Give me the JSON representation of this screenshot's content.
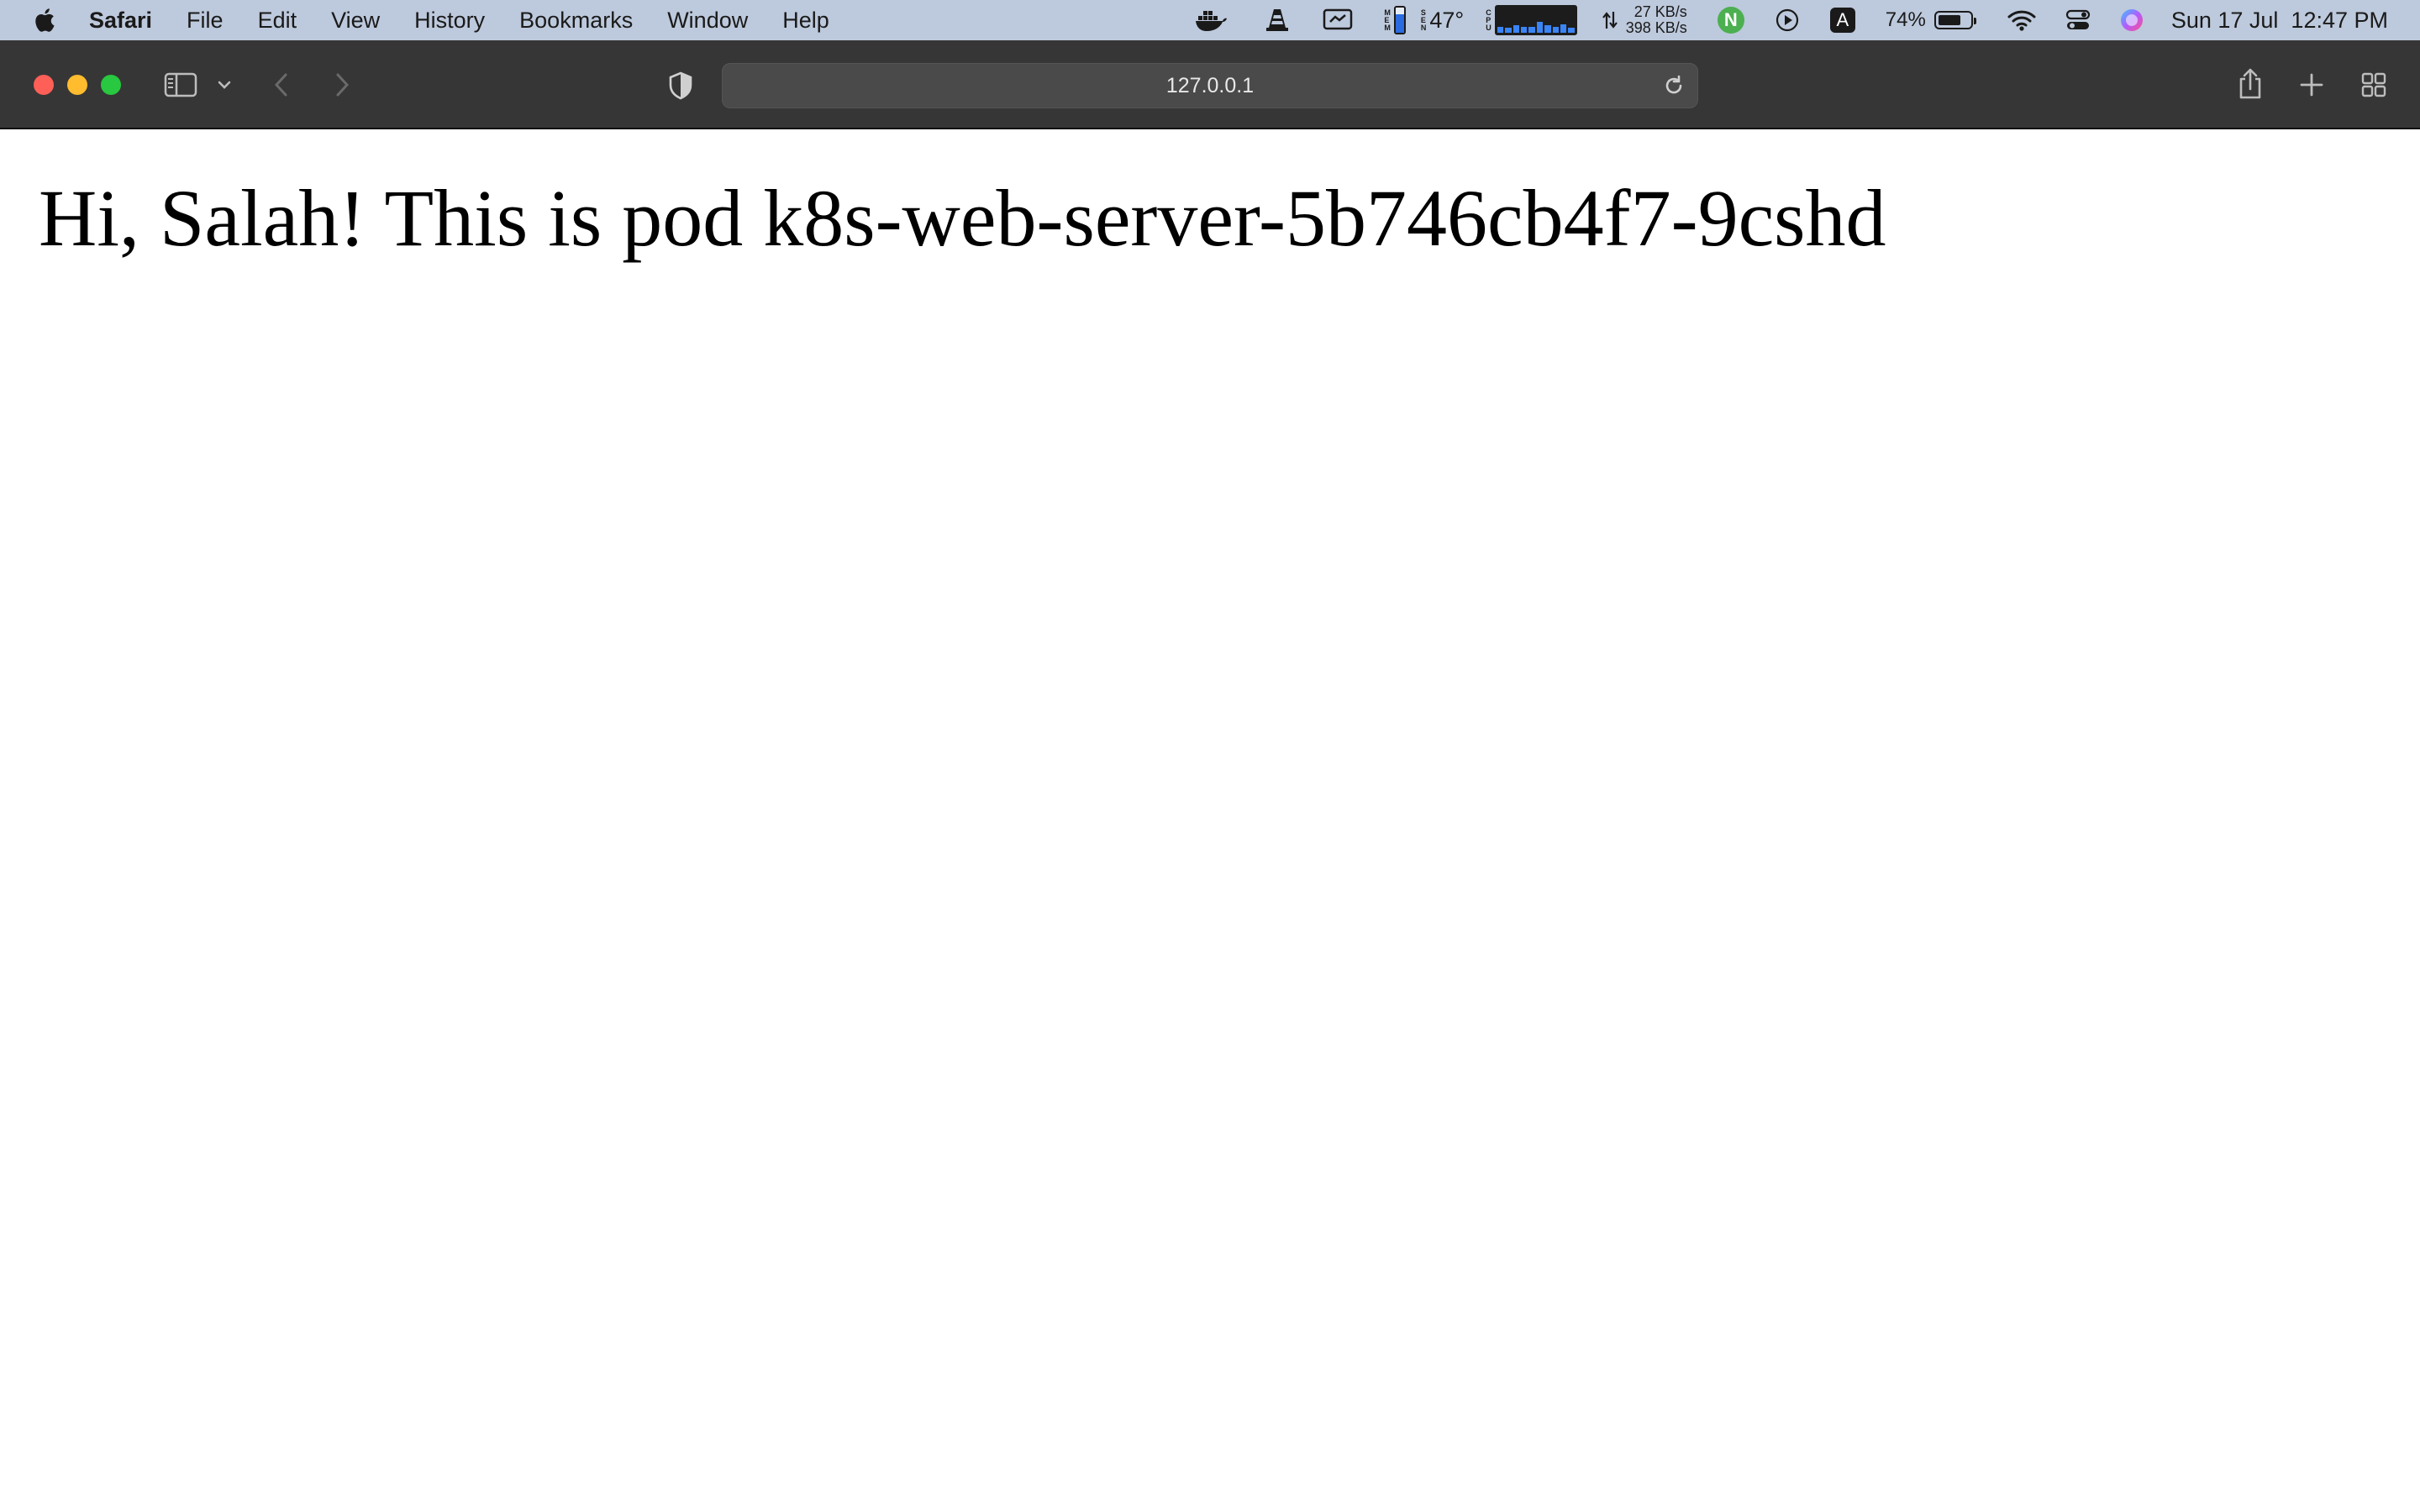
{
  "menubar": {
    "app_name": "Safari",
    "items": [
      "File",
      "Edit",
      "View",
      "History",
      "Bookmarks",
      "Window",
      "Help"
    ],
    "temperature": "47°",
    "mem_fill_fraction": 0.75,
    "cpu_bars": [
      0.25,
      0.2,
      0.3,
      0.22,
      0.25,
      0.45,
      0.3,
      0.25,
      0.35,
      0.2
    ],
    "net_up": "27 KB/s",
    "net_down": "398 KB/s",
    "n_badge": "N",
    "input_badge": "A",
    "battery_percent": "74%",
    "battery_level": 0.74,
    "datetime": "Sun 17 Jul  12:47 PM",
    "colors": {
      "bar_bg": "#bdc9dc",
      "mem_fill": "#2b6be0",
      "n_badge": "#4caf50"
    }
  },
  "toolbar": {
    "url": "127.0.0.1",
    "colors": {
      "close": "#fe5f57",
      "minimize": "#febc2e",
      "zoom": "#28c840",
      "bg": "#363636"
    }
  },
  "page": {
    "heading": "Hi, Salah! This is pod k8s-web-server-5b746cb4f7-9cshd"
  }
}
